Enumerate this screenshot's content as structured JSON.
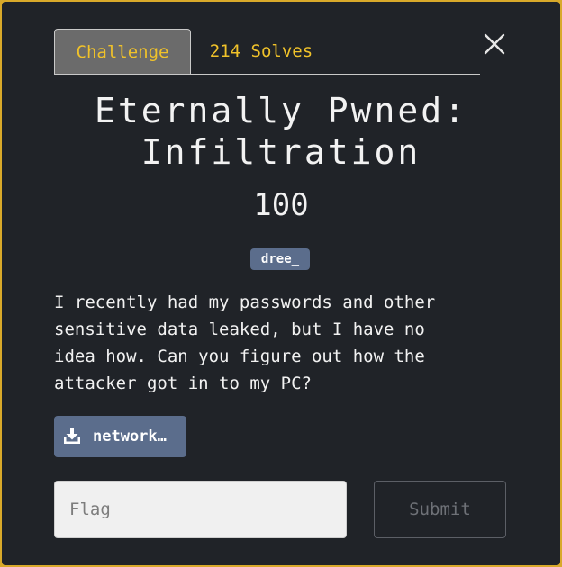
{
  "tabs": {
    "challenge": "Challenge",
    "solves": "214 Solves"
  },
  "challenge": {
    "title_line1": "Eternally Pwned:",
    "title_line2": "Infiltration",
    "points": "100",
    "author_tag": "dree_",
    "description": "I recently had my passwords and other\nsensitive data leaked, but I have no\nidea how. Can you figure out how the\nattacker got in to my PC?",
    "file_label": "network…"
  },
  "form": {
    "flag_placeholder": "Flag",
    "submit_label": "Submit"
  },
  "icons": {
    "close": "close-icon",
    "download": "download-icon"
  },
  "colors": {
    "modal_bg": "#202328",
    "accent_yellow": "#f0c22a",
    "tag_bg": "#5b6d8c",
    "outer_bg": "#d8a92a"
  }
}
